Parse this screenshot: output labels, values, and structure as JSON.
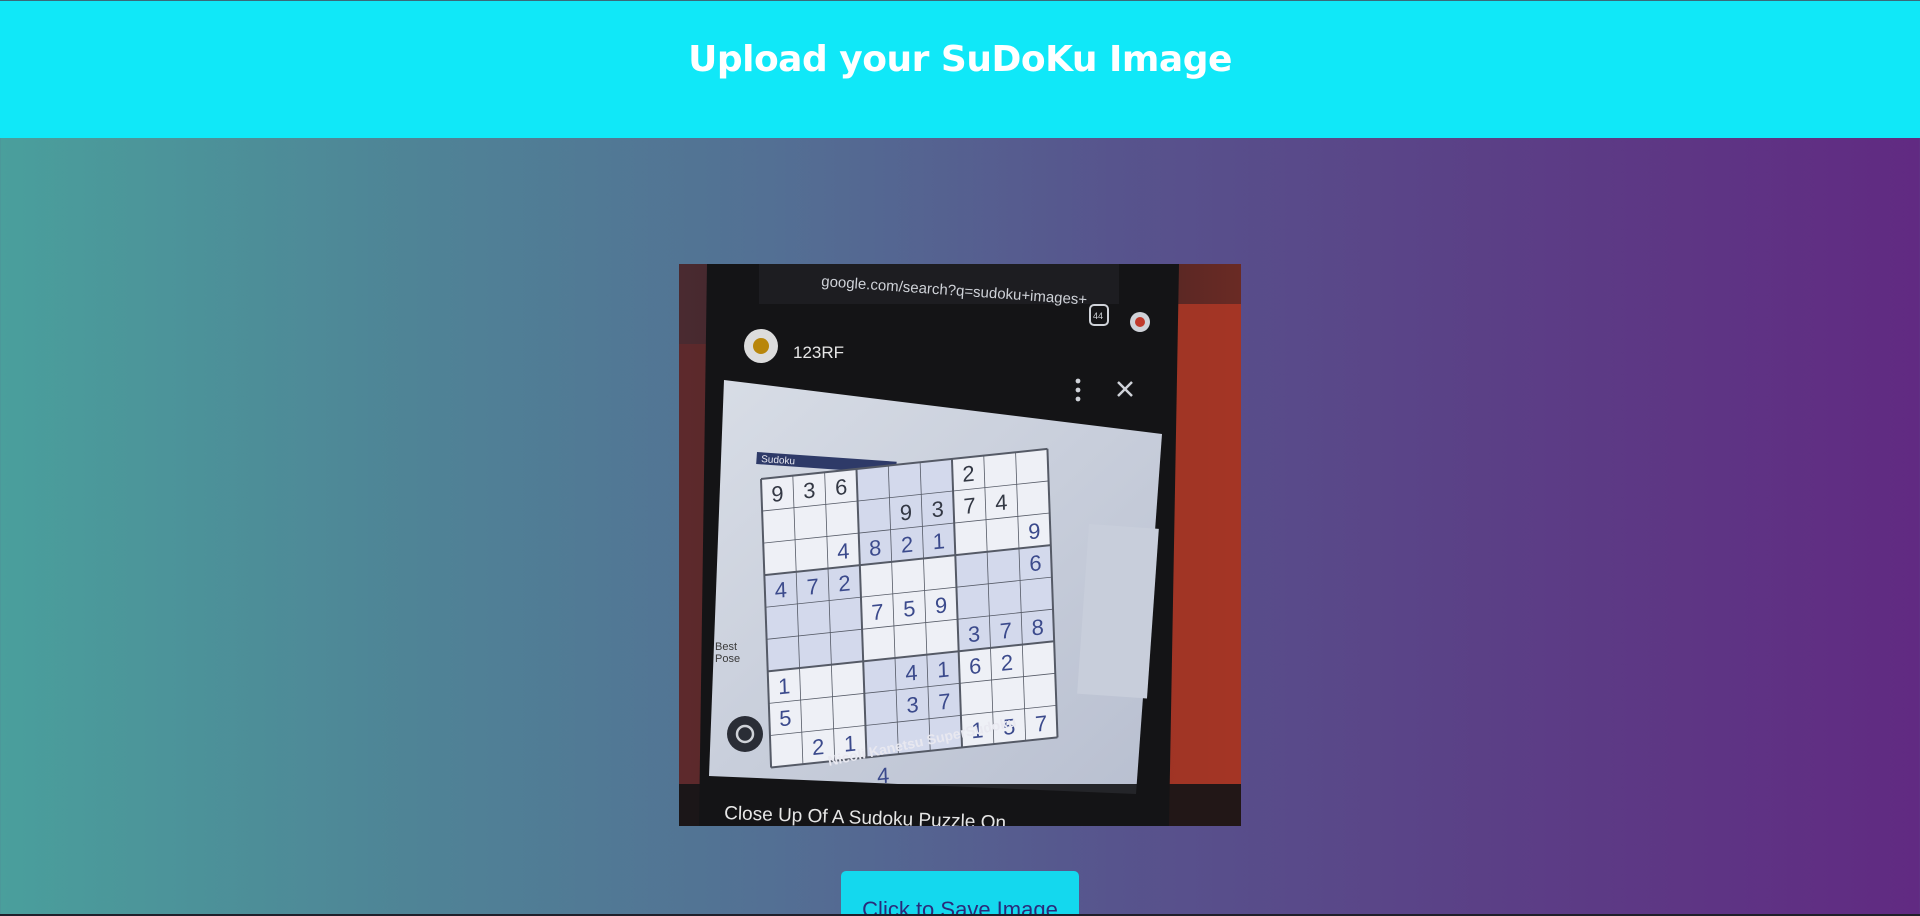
{
  "header": {
    "title": "Upload your SuDoKu Image"
  },
  "uploaded_image": {
    "address_bar": "google.com/search?q=sudoku+images+",
    "tab_count": "44",
    "source_name": "123RF",
    "caption": "Close Up Of A Sudoku Puzzle On",
    "book_header": "Sudoku",
    "book_footer": "Nicoli Kanetsu SuperSudoku",
    "side_labels": [
      "Best",
      "Pose"
    ],
    "grid_rows": [
      [
        "9",
        "3",
        "6",
        "",
        "",
        "",
        "2",
        "",
        ""
      ],
      [
        "",
        "",
        "",
        "",
        "9",
        "3",
        "7",
        "4",
        ""
      ],
      [
        "",
        "",
        "4",
        "8",
        "2",
        "1",
        "",
        "",
        "9"
      ],
      [
        "4",
        "7",
        "2",
        "",
        "",
        "",
        "",
        "",
        "6"
      ],
      [
        "",
        "",
        "",
        "7",
        "5",
        "9",
        "",
        "",
        ""
      ],
      [
        "",
        "",
        "",
        "",
        "",
        "",
        "3",
        "7",
        "8"
      ],
      [
        "1",
        "",
        "",
        "",
        "4",
        "1",
        "6",
        "2",
        ""
      ],
      [
        "5",
        "",
        "",
        "",
        "3",
        "7",
        "",
        "",
        ""
      ],
      [
        "",
        "2",
        "1",
        "",
        "",
        "",
        "1",
        "5",
        "7"
      ]
    ],
    "extra_digit": "4"
  },
  "actions": {
    "save_label": "Click to Save Image"
  },
  "colors": {
    "header_bg": "#10e8f8",
    "button_bg": "#14d8ee",
    "button_text": "#2a2a7a"
  },
  "icons": {
    "lens": "google-lens-icon",
    "more": "more-vert-icon",
    "close": "close-icon",
    "tabs": "tab-count-icon",
    "profile": "profile-avatar-icon"
  }
}
